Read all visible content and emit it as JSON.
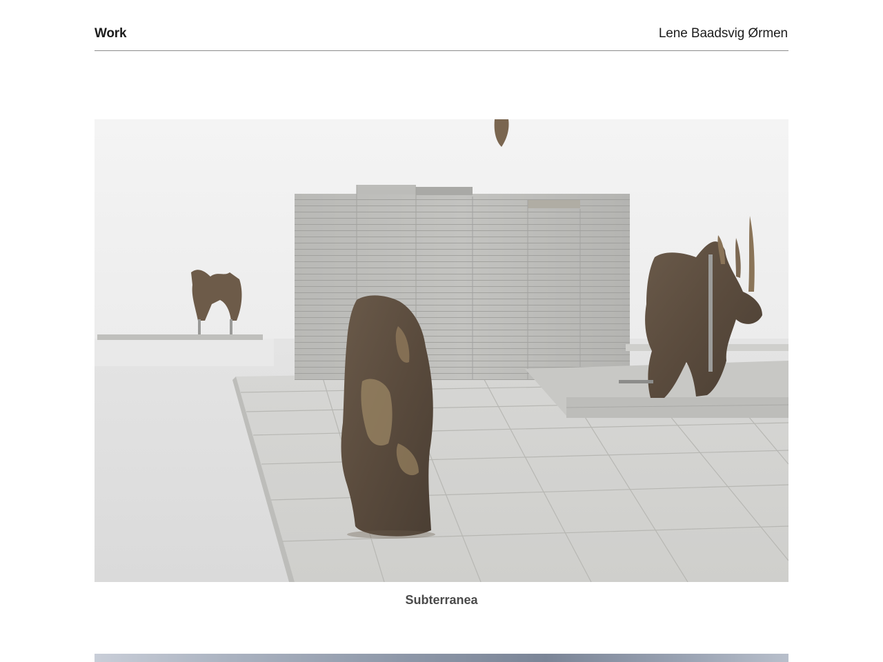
{
  "header": {
    "nav_label": "Work",
    "artist_name": "Lene Baadsvig Ørmen"
  },
  "works": [
    {
      "title": "Subterranea",
      "image_subject": "gallery-installation-photo"
    }
  ]
}
